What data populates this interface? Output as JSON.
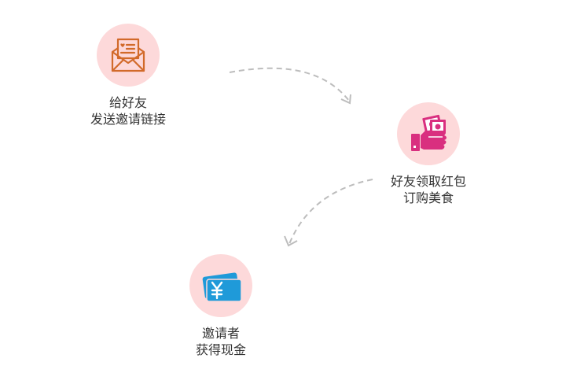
{
  "colors": {
    "circle_bg": "#fdd9da",
    "envelope": "#d26a2a",
    "hand": "#d92f7f",
    "card": "#1f9ad9",
    "arrow": "#bdbdbd",
    "text": "#333333"
  },
  "steps": [
    {
      "icon": "envelope-heart-icon",
      "line1": "给好友",
      "line2": "发送邀请链接"
    },
    {
      "icon": "hand-money-icon",
      "line1": "好友领取红包",
      "line2": "订购美食"
    },
    {
      "icon": "yuan-card-icon",
      "line1": "邀请者",
      "line2": "获得现金"
    }
  ]
}
